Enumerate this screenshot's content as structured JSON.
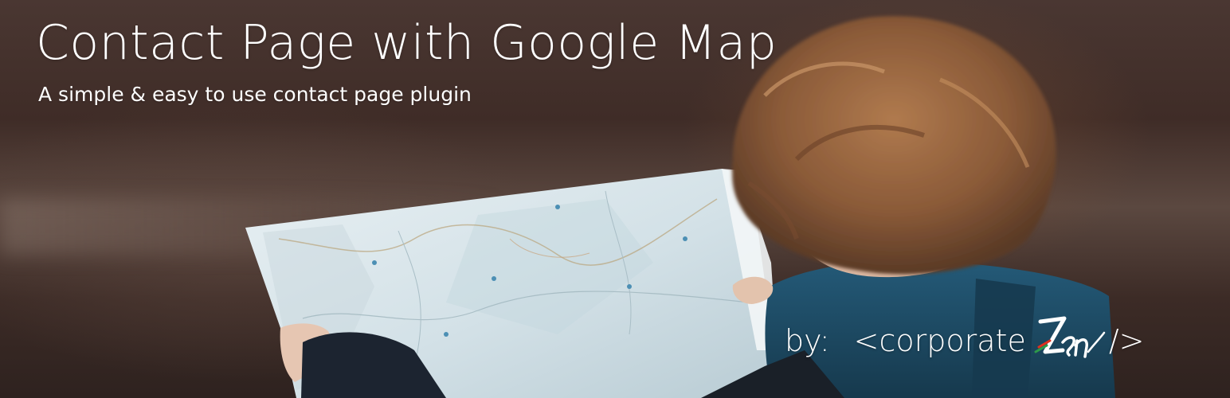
{
  "banner": {
    "title": "Contact Page with Google Map",
    "subtitle": "A simple & easy to use contact page plugin"
  },
  "credit": {
    "by_label": "by:",
    "open_bracket": "<",
    "company_name": "corporate",
    "logo_text": "Zen",
    "close_bracket": "/>"
  },
  "colors": {
    "text": "#ffffff",
    "background_dark": "#3f2c27",
    "map_paper": "#dfe9ee",
    "jacket": "#1e4c66",
    "hair": "#8a5a38",
    "logo_red": "#e0301e",
    "logo_green": "#2e9a4a"
  },
  "icons": {
    "logo": "corporate-zen-logo-icon"
  }
}
